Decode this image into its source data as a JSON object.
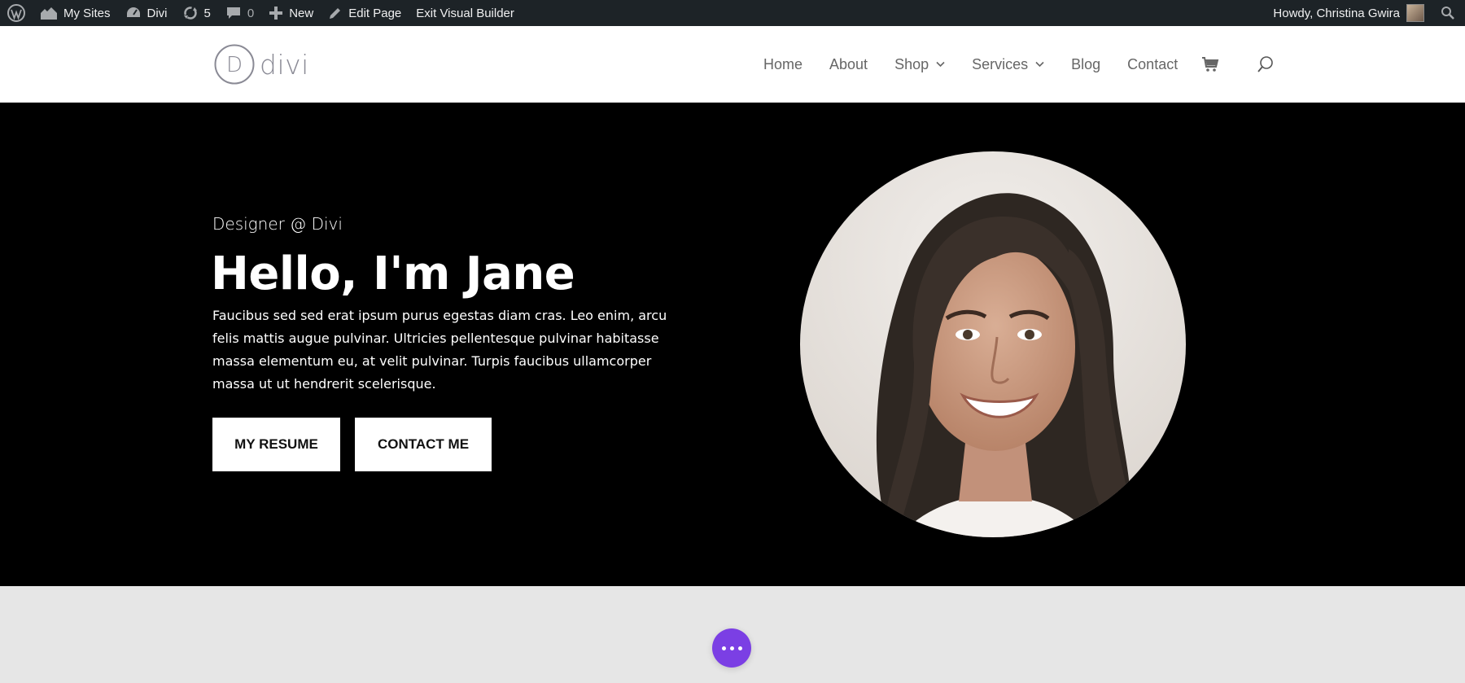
{
  "adminbar": {
    "my_sites": "My Sites",
    "site_name": "Divi",
    "updates_count": "5",
    "comments_count": "0",
    "new_label": "New",
    "edit_page": "Edit Page",
    "exit_builder": "Exit Visual Builder",
    "howdy": "Howdy, Christina Gwira"
  },
  "header": {
    "logo_text": "divi",
    "logo_letter": "D",
    "nav": [
      {
        "label": "Home"
      },
      {
        "label": "About"
      },
      {
        "label": "Shop"
      },
      {
        "label": "Services"
      },
      {
        "label": "Blog"
      },
      {
        "label": "Contact"
      }
    ]
  },
  "hero": {
    "subtitle": "Designer @ Divi",
    "headline": "Hello, I'm Jane",
    "bio": "Faucibus sed sed erat ipsum purus egestas diam cras. Leo enim, arcu felis mattis augue pulvinar. Ultricies pellentesque pulvinar habitasse massa elementum eu, at velit pulvinar. Turpis faucibus ullamcorper massa ut ut hendrerit scelerisque.",
    "btn_resume": "MY RESUME",
    "btn_contact": "CONTACT ME"
  },
  "colors": {
    "adminbar_bg": "#1d2327",
    "hero_bg": "#000000",
    "section_bg": "#e6e6e6",
    "builder_accent": "#7b3fe4"
  }
}
